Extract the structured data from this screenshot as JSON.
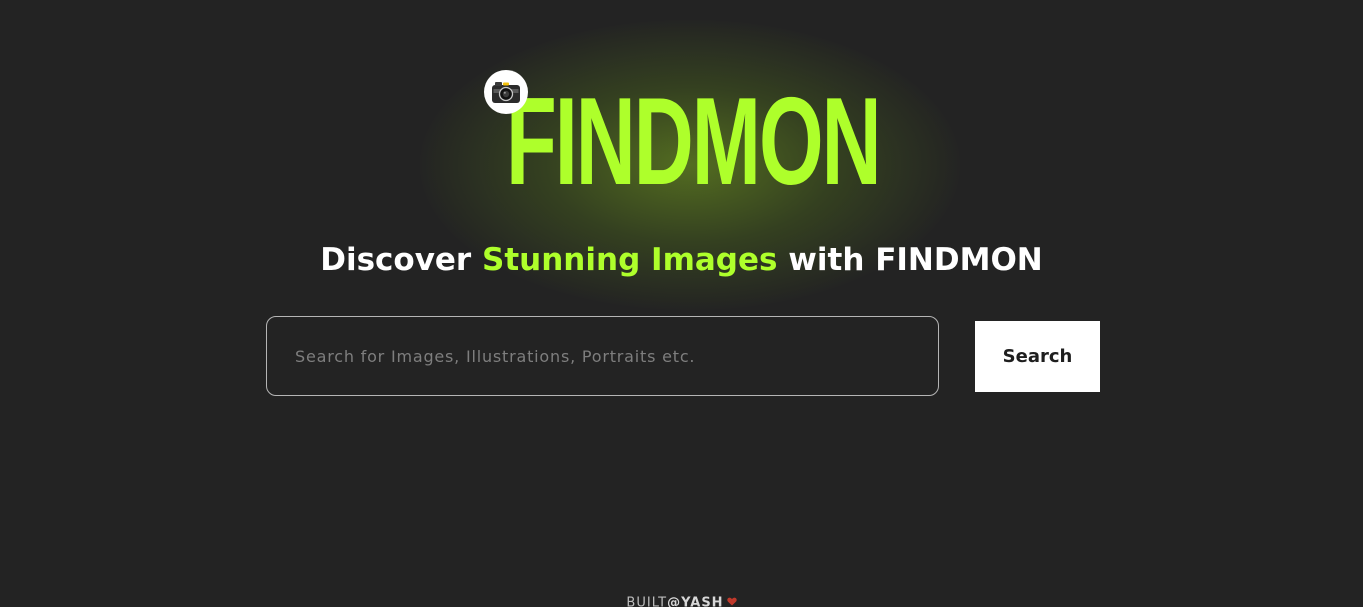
{
  "hero": {
    "logo_icon": "camera-icon",
    "logo_text": "FINDMON",
    "accent_color": "#aeff2b"
  },
  "tagline": {
    "prefix": "Discover ",
    "highlight": "Stunning Images",
    "suffix": " with FINDMON"
  },
  "search": {
    "placeholder": "Search for Images, Illustrations, Portraits etc.",
    "value": "",
    "button_label": "Search"
  },
  "footer": {
    "built_label": "BUILT",
    "at_symbol": "@",
    "author": "YASH",
    "icon": "heart-icon",
    "icon_color": "#c0392b"
  }
}
